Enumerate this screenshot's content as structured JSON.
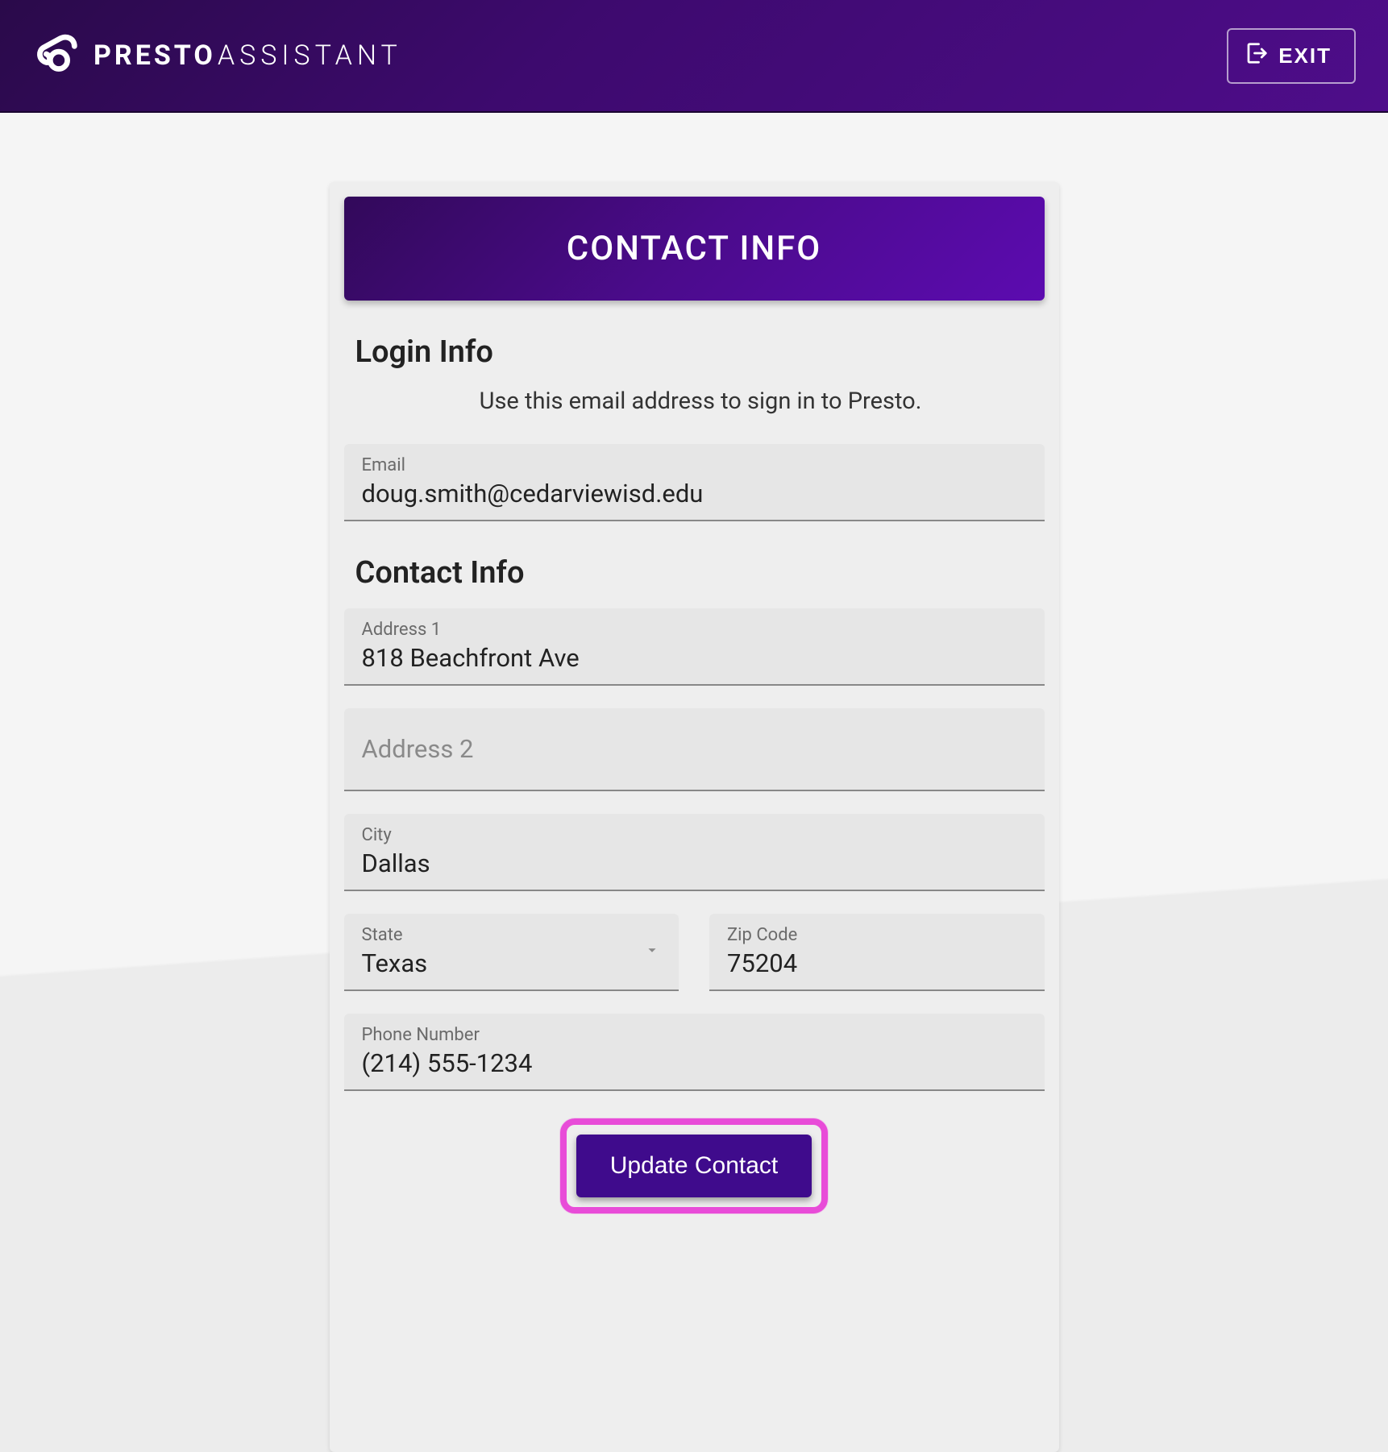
{
  "header": {
    "brand_bold": "PRESTO",
    "brand_light": "ASSISTANT",
    "exit_label": "EXIT"
  },
  "card": {
    "title": "CONTACT INFO",
    "login_section_title": "Login Info",
    "login_helper": "Use this email address to sign in to Presto.",
    "contact_section_title": "Contact Info",
    "submit_label": "Update Contact"
  },
  "fields": {
    "email": {
      "label": "Email",
      "value": "doug.smith@cedarviewisd.edu"
    },
    "address1": {
      "label": "Address 1",
      "value": "818 Beachfront Ave"
    },
    "address2": {
      "placeholder": "Address 2",
      "value": ""
    },
    "city": {
      "label": "City",
      "value": "Dallas"
    },
    "state": {
      "label": "State",
      "value": "Texas"
    },
    "zip": {
      "label": "Zip Code",
      "value": "75204"
    },
    "phone": {
      "label": "Phone Number",
      "value": "(214) 555-1234"
    }
  }
}
